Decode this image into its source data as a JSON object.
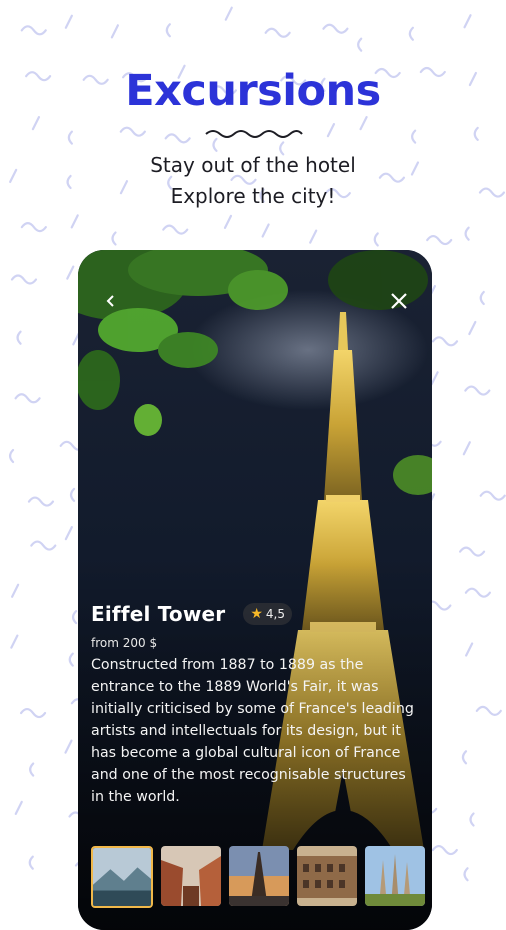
{
  "header": {
    "title": "Excursions",
    "subtitle_line1": "Stay out of the hotel",
    "subtitle_line2": "Explore the city!"
  },
  "card": {
    "back_icon": "chevron-left-icon",
    "close_icon": "close-icon",
    "place": {
      "name": "Eiffel Tower",
      "rating": "4,5",
      "price": "from 200 $",
      "description": "Constructed from 1887 to 1889 as the entrance to the 1889 World's Fair, it was initially criticised by some of France's leading artists and intellectuals for its design, but it has become a global cultural icon of France and one of the most recognisable structures in the world."
    },
    "thumbnails": [
      "mountain-lake",
      "red-canyon",
      "eiffel-tower-sunset",
      "colosseum",
      "sagrada-familia"
    ]
  },
  "colors": {
    "title": "#2c33d8",
    "pattern": "#c8cbf2",
    "rating_star": "#f7b928",
    "selected_thumb_border": "#f1b84a"
  }
}
